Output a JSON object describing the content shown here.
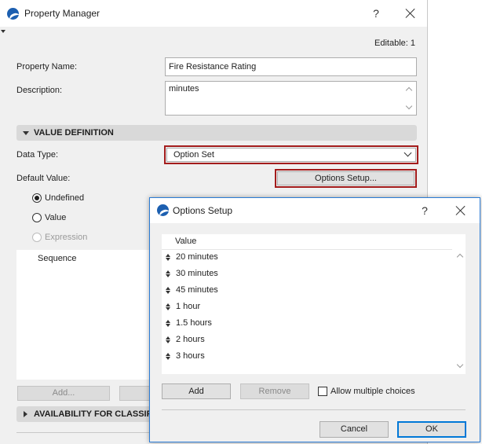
{
  "property_manager": {
    "title": "Property Manager",
    "help": "?",
    "editable_label": "Editable: 1",
    "property_name_label": "Property Name:",
    "property_name_value": "Fire Resistance Rating",
    "description_label": "Description:",
    "description_value": "minutes",
    "value_definition_header": "VALUE DEFINITION",
    "data_type_label": "Data Type:",
    "data_type_value": "Option Set",
    "default_value_label": "Default Value:",
    "options_setup_button": "Options Setup...",
    "radio_undefined": "Undefined",
    "radio_value": "Value",
    "radio_expression": "Expression",
    "sequence_label": "Sequence",
    "add_button": "Add...",
    "availability_header": "AVAILABILITY FOR CLASSIFIC"
  },
  "options_setup": {
    "title": "Options Setup",
    "help": "?",
    "column_header": "Value",
    "options": [
      "20 minutes",
      "30 minutes",
      "45 minutes",
      "1 hour",
      "1.5 hours",
      "2 hours",
      "3 hours"
    ],
    "add_button": "Add",
    "remove_button": "Remove",
    "allow_multiple_label": "Allow multiple choices",
    "cancel_button": "Cancel",
    "ok_button": "OK"
  },
  "colors": {
    "accent": "#0078d7",
    "highlight": "#a31c1c",
    "logo": "#1c5fb0"
  }
}
